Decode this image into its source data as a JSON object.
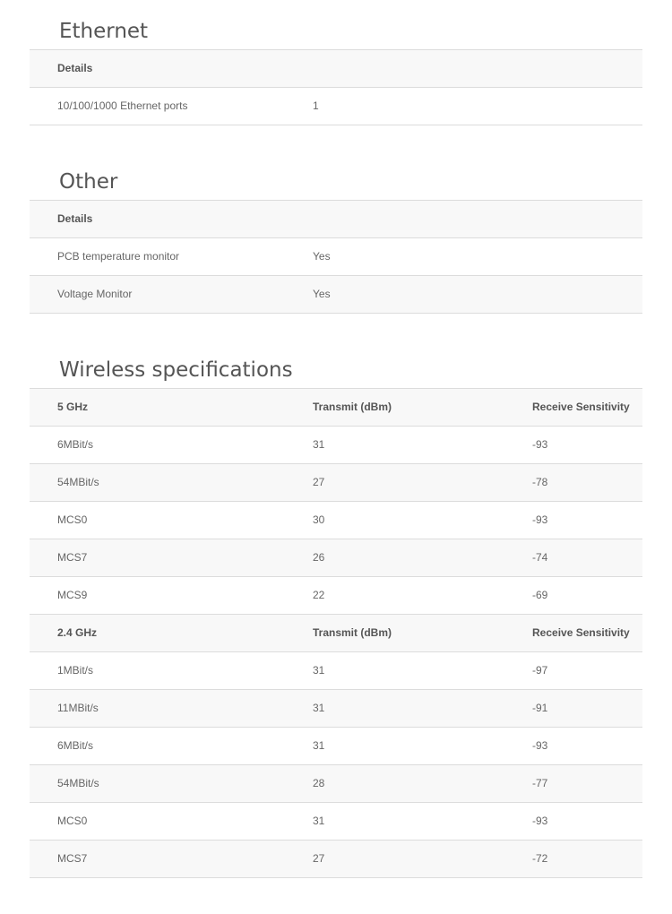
{
  "ethernet": {
    "title": "Ethernet",
    "rows": [
      {
        "cells": [
          "Details"
        ],
        "head": true
      },
      {
        "cells": [
          "10/100/1000 Ethernet ports",
          "1"
        ]
      }
    ]
  },
  "other": {
    "title": "Other",
    "rows": [
      {
        "cells": [
          "Details"
        ],
        "head": true
      },
      {
        "cells": [
          "PCB temperature monitor",
          "Yes"
        ]
      },
      {
        "cells": [
          "Voltage Monitor",
          "Yes"
        ]
      }
    ]
  },
  "wireless": {
    "title": "Wireless specifications",
    "rows": [
      {
        "cells": [
          "5 GHz",
          "Transmit (dBm)",
          "Receive Sensitivity"
        ],
        "head": true
      },
      {
        "cells": [
          "6MBit/s",
          "31",
          "-93"
        ]
      },
      {
        "cells": [
          "54MBit/s",
          "27",
          "-78"
        ]
      },
      {
        "cells": [
          "MCS0",
          "30",
          "-93"
        ]
      },
      {
        "cells": [
          "MCS7",
          "26",
          "-74"
        ]
      },
      {
        "cells": [
          "MCS9",
          "22",
          "-69"
        ]
      },
      {
        "cells": [
          "2.4 GHz",
          "Transmit (dBm)",
          "Receive Sensitivity"
        ],
        "head": true
      },
      {
        "cells": [
          "1MBit/s",
          "31",
          "-97"
        ]
      },
      {
        "cells": [
          "11MBit/s",
          "31",
          "-91"
        ]
      },
      {
        "cells": [
          "6MBit/s",
          "31",
          "-93"
        ]
      },
      {
        "cells": [
          "54MBit/s",
          "28",
          "-77"
        ]
      },
      {
        "cells": [
          "MCS0",
          "31",
          "-93"
        ]
      },
      {
        "cells": [
          "MCS7",
          "27",
          "-72"
        ]
      }
    ]
  }
}
